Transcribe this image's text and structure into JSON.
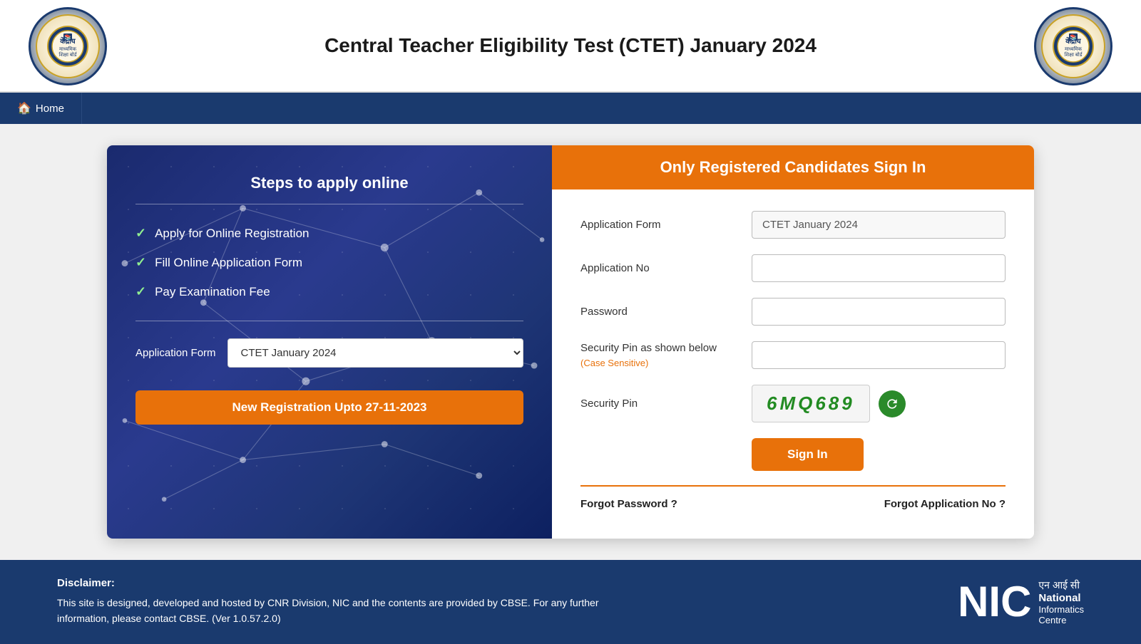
{
  "header": {
    "title": "Central Teacher Eligibility Test (CTET) January 2024"
  },
  "navbar": {
    "home_label": "Home",
    "home_icon": "🏠"
  },
  "left_panel": {
    "title": "Steps to apply online",
    "steps": [
      "Apply for Online Registration",
      "Fill Online Application Form",
      "Pay Examination Fee"
    ],
    "app_form_label": "Application Form",
    "app_form_value": "CTET January 2024",
    "new_reg_button": "New Registration Upto 27-11-2023"
  },
  "right_panel": {
    "header": "Only Registered Candidates Sign In",
    "fields": {
      "application_form_label": "Application Form",
      "application_form_value": "CTET January 2024",
      "application_no_label": "Application No",
      "application_no_placeholder": "",
      "password_label": "Password",
      "password_placeholder": "",
      "security_pin_label": "Security Pin as shown below",
      "case_sensitive_note": "(Case Sensitive)",
      "security_pin_row_label": "Security Pin",
      "captcha_value": "6MQ689"
    },
    "sign_in_button": "Sign In",
    "forgot_password": "Forgot Password ?",
    "forgot_application": "Forgot Application No ?"
  },
  "footer": {
    "disclaimer_title": "Disclaimer:",
    "disclaimer_text": "This site is designed, developed and hosted by CNR Division, NIC and the contents are provided by CBSE. For any further information, please contact CBSE. (Ver 1.0.57.2.0)",
    "nic_text": "NIC",
    "nic_hindi": "एन आई सी",
    "nic_full_name": "National",
    "nic_full_name2": "Informatics",
    "nic_full_name3": "Centre"
  }
}
